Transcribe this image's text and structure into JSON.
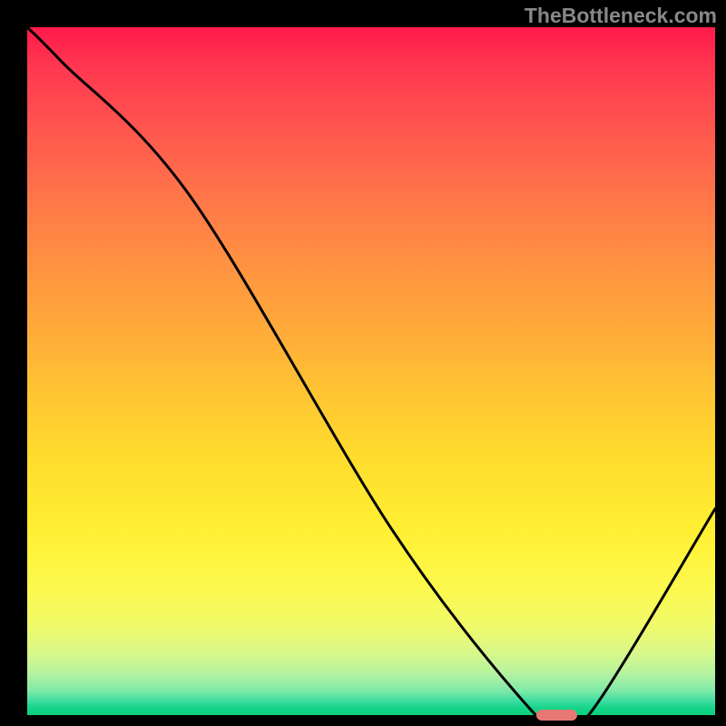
{
  "watermark": "TheBottleneck.com",
  "chart_data": {
    "type": "line",
    "title": "",
    "xlabel": "",
    "ylabel": "",
    "xlim": [
      0,
      100
    ],
    "ylim": [
      0,
      100
    ],
    "x": [
      0,
      5,
      24,
      53,
      73,
      77,
      82,
      100
    ],
    "values": [
      100,
      95,
      75,
      27,
      1,
      0,
      0.5,
      30
    ],
    "marker": {
      "x": 77,
      "y": 0,
      "width_frac": 0.06,
      "height_frac": 0.015
    },
    "background_gradient": {
      "top_color": "#ff1a4a",
      "bottom_color": "#0dcf7e"
    }
  }
}
